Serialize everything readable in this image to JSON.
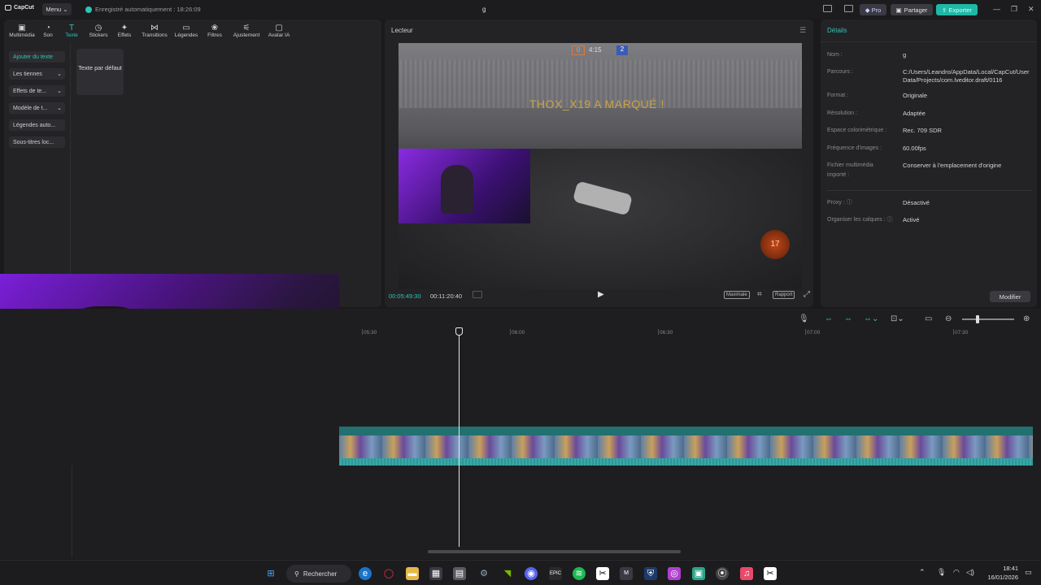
{
  "titlebar": {
    "app_name": "CapCut",
    "menu_label": "Menu",
    "autosave_text": "Enregistré automatiquement : 18:26:09",
    "project_name": "g",
    "pro_label": "Pro",
    "share_label": "Partager",
    "export_label": "Exporter"
  },
  "toolbar": {
    "items": [
      {
        "label": "Multimédia",
        "icon": "media-icon"
      },
      {
        "label": "Son",
        "icon": "audio-icon"
      },
      {
        "label": "Texte",
        "icon": "text-icon"
      },
      {
        "label": "Stickers",
        "icon": "sticker-icon"
      },
      {
        "label": "Effets",
        "icon": "effects-icon"
      },
      {
        "label": "Transitions",
        "icon": "transitions-icon"
      },
      {
        "label": "Légendes",
        "icon": "captions-icon"
      },
      {
        "label": "Filtres",
        "icon": "filters-icon"
      },
      {
        "label": "Ajustement",
        "icon": "adjust-icon"
      },
      {
        "label": "Avatar IA",
        "icon": "avatar-icon"
      }
    ],
    "active": "Texte"
  },
  "sidebar": {
    "items": [
      {
        "label": "Ajouter du texte"
      },
      {
        "label": "Les tiennes"
      },
      {
        "label": "Effets de te..."
      },
      {
        "label": "Modèle de t..."
      },
      {
        "label": "Légendes auto..."
      },
      {
        "label": "Sous-titres loc..."
      }
    ]
  },
  "preset": {
    "label": "Texte par défaut"
  },
  "player": {
    "title": "Lecteur",
    "current_time": "00:05:49:30",
    "total_time": "00:11:20:40",
    "maximize_label": "Maximale",
    "ratio_label": "Rapport",
    "game": {
      "score_left": "0",
      "score_right": "2",
      "clock": "4:15",
      "goal_text": "THOX_X19 A MARQUÉ !",
      "boost": "17"
    }
  },
  "details": {
    "title": "Détails",
    "fields": [
      {
        "label": "Nom :",
        "value": "g"
      },
      {
        "label": "Parcours :",
        "value": "C:/Users/Leandro/AppData/Local/CapCut/User Data/Projects/com.lveditor.draft/0116"
      },
      {
        "label": "Format :",
        "value": "Originale"
      },
      {
        "label": "Résolution :",
        "value": "Adaptée"
      },
      {
        "label": "Espace colorimétrique :",
        "value": "Rec. 709 SDR"
      },
      {
        "label": "Fréquence d'images :",
        "value": "60.00fps"
      },
      {
        "label": "Fichier multimédia importé :",
        "value": "Conserver à l'emplacement d'origine"
      },
      {
        "label": "Proxy :",
        "value": "Désactivé"
      },
      {
        "label": "Organiser les calques :",
        "value": "Activé"
      }
    ],
    "modify_label": "Modifier"
  },
  "timeline": {
    "ruler": [
      "05:30",
      "06:00",
      "06:30",
      "07:00",
      "07:30"
    ]
  },
  "taskbar": {
    "search_label": "Rechercher",
    "time": "18:41",
    "date": "16/01/2026"
  },
  "colors": {
    "accent": "#2ec4b6",
    "export": "#1fb8a6",
    "clip": "#1f6a6a"
  }
}
